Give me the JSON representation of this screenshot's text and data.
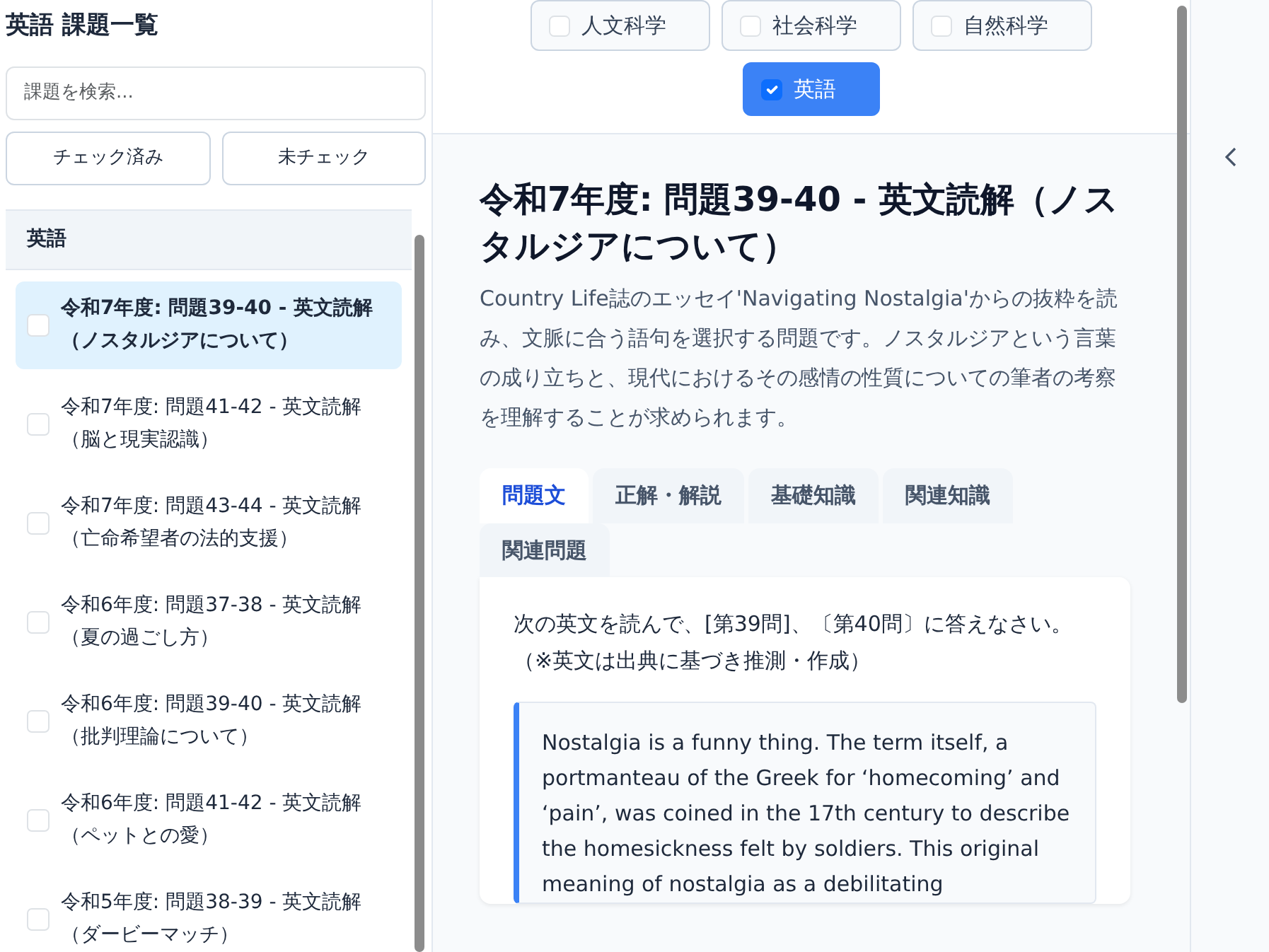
{
  "sidebar": {
    "title": "英語 課題一覧",
    "search": {
      "placeholder": "課題を検索..."
    },
    "filter_buttons": [
      "チェック済み",
      "未チェック"
    ],
    "section": {
      "title": "英語",
      "items": [
        {
          "label": "令和7年度: 問題39-40 - 英文読解（ノスタルジアについて）",
          "checked": false,
          "selected": true
        },
        {
          "label": "令和7年度: 問題41-42 - 英文読解（脳と現実認識）",
          "checked": false,
          "selected": false
        },
        {
          "label": "令和7年度: 問題43-44 - 英文読解（亡命希望者の法的支援）",
          "checked": false,
          "selected": false
        },
        {
          "label": "令和6年度: 問題37-38 - 英文読解（夏の過ごし方）",
          "checked": false,
          "selected": false
        },
        {
          "label": "令和6年度: 問題39-40 - 英文読解（批判理論について）",
          "checked": false,
          "selected": false
        },
        {
          "label": "令和6年度: 問題41-42 - 英文読解（ペットとの愛）",
          "checked": false,
          "selected": false
        },
        {
          "label": "令和5年度: 問題38-39 - 英文読解（ダービーマッチ）",
          "checked": false,
          "selected": false
        }
      ]
    }
  },
  "categories": [
    {
      "label": "人文科学",
      "checked": false
    },
    {
      "label": "社会科学",
      "checked": false
    },
    {
      "label": "自然科学",
      "checked": false
    },
    {
      "label": "英語",
      "checked": true
    }
  ],
  "detail": {
    "title": "令和7年度: 問題39-40 - 英文読解（ノスタルジアについて）",
    "description": "Country Life誌のエッセイ'Navigating Nostalgia'からの抜粋を読み、文脈に合う語句を選択する問題です。ノスタルジアという言葉の成り立ちと、現代におけるその感情の性質についての筆者の考察を理解することが求められます。",
    "tabs": [
      {
        "label": "問題文",
        "selected": true
      },
      {
        "label": "正解・解説",
        "selected": false
      },
      {
        "label": "基礎知識",
        "selected": false
      },
      {
        "label": "関連知識",
        "selected": false
      },
      {
        "label": "関連問題",
        "selected": false
      }
    ],
    "instruction": "次の英文を読んで、[第39問]、〔第40問〕に答えなさい。（※英文は出典に基づき推測・作成）",
    "passage": "Nostalgia is a funny thing. The term itself, a portmanteau of the Greek for ‘homecoming’ and ‘pain’, was coined in the 17th century to describe the homesickness felt by soldiers. This original meaning of nostalgia as a debilitating"
  }
}
